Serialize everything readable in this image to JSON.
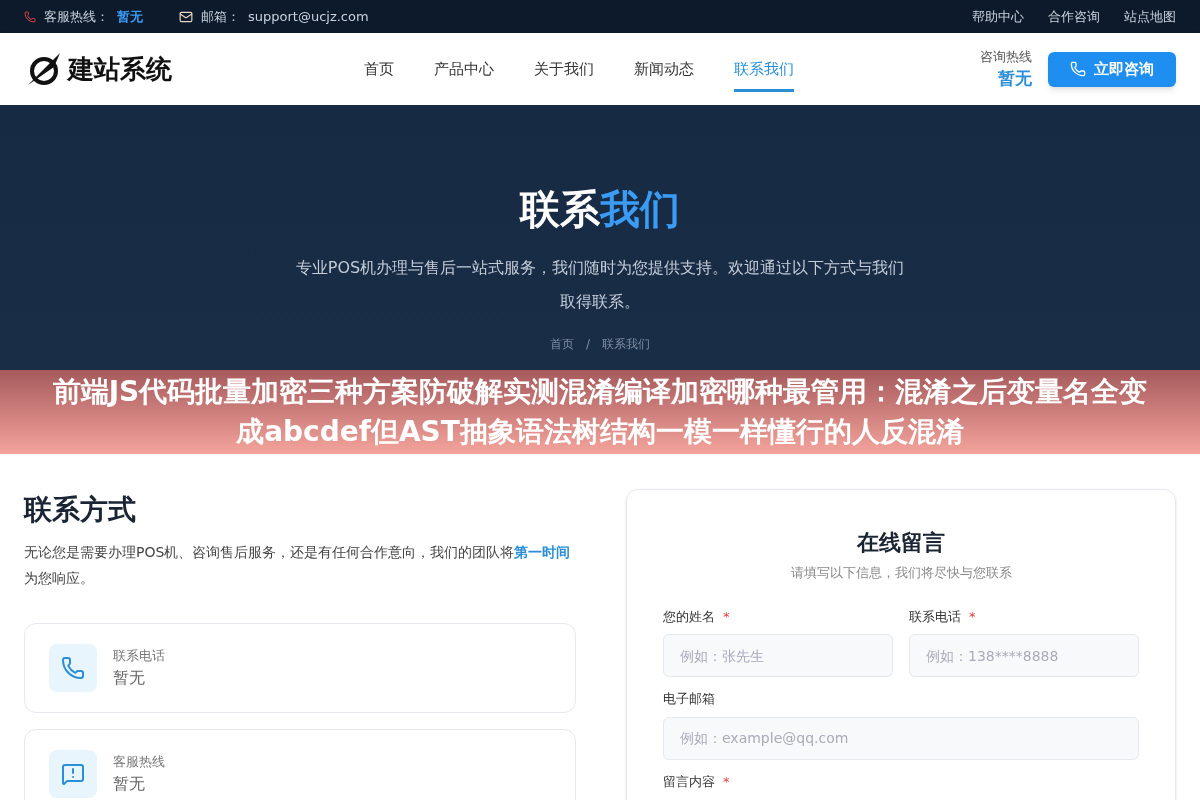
{
  "top_bar": {
    "hotline_label": "客服热线：",
    "hotline_value": "暂无",
    "email_label": "邮箱：",
    "email_value": "support@ucjz.com",
    "links": [
      "帮助中心",
      "合作咨询",
      "站点地图"
    ]
  },
  "header": {
    "logo_text": "建站系统",
    "nav": [
      {
        "label": "首页",
        "selected": false
      },
      {
        "label": "产品中心",
        "selected": false
      },
      {
        "label": "关于我们",
        "selected": false
      },
      {
        "label": "新闻动态",
        "selected": false
      },
      {
        "label": "联系我们",
        "selected": true
      }
    ],
    "hotline_label": "咨询热线",
    "hotline_value": "暂无",
    "cta": "立即咨询"
  },
  "hero": {
    "title": "联系",
    "title_highlight": "我们",
    "subtitle": "专业POS机办理与售后一站式服务，我们随时为您提供支持。欢迎通过以下方式与我们取得联系。",
    "breadcrumb": [
      "首页",
      "联系我们"
    ],
    "breadcrumb_separator": "/"
  },
  "banner": {
    "text": "前端JS代码批量加密三种方案防破解实测混淆编译加密哪种最管用：混淆之后变量名全变成abcdef但AST抽象语法树结构一模一样懂行的人反混淆"
  },
  "contact": {
    "title": "联系方式",
    "intro": "无论您是需要办理POS机、咨询售后服务，还是有任何合作意向，我们的团队将**第一时间**为您响应。",
    "cards": [
      {
        "kind": "phone",
        "label": "联系电话",
        "value": "暂无"
      },
      {
        "kind": "message",
        "label": "客服热线",
        "value": "暂无"
      }
    ]
  },
  "form": {
    "title": "在线留言",
    "subtitle": "请填写以下信息，我们将尽快与您联系",
    "fields": [
      {
        "label": "您的姓名",
        "required_mark": "*",
        "placeholder": "例如：张先生",
        "kind": "half"
      },
      {
        "label": "联系电话",
        "required_mark": "*",
        "placeholder": "例如：138****8888",
        "kind": "half"
      },
      {
        "label": "电子邮箱",
        "placeholder": "例如：example@qq.com",
        "kind": "full"
      },
      {
        "label": "留言内容",
        "required_mark": "*",
        "kind": "full"
      }
    ]
  }
}
